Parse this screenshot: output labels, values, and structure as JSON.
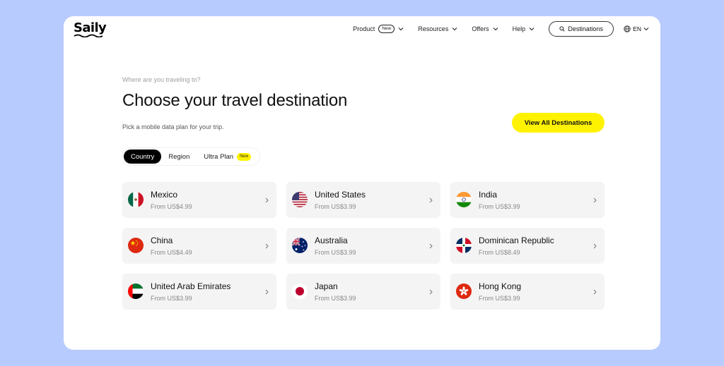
{
  "brand": {
    "name": "Saily"
  },
  "nav": {
    "items": [
      {
        "label": "Product",
        "badge": "New"
      },
      {
        "label": "Resources"
      },
      {
        "label": "Offers"
      },
      {
        "label": "Help"
      }
    ],
    "destinations_button": "Destinations",
    "language": "EN"
  },
  "hero": {
    "eyebrow": "Where are you traveling to?",
    "title": "Choose your travel destination",
    "subtitle": "Pick a mobile data plan for your trip.",
    "view_all_label": "View All Destinations"
  },
  "tabs": [
    {
      "label": "Country",
      "active": true
    },
    {
      "label": "Region",
      "active": false
    },
    {
      "label": "Ultra Plan",
      "badge": "New",
      "active": false
    }
  ],
  "countries": [
    {
      "name": "Mexico",
      "price": "From US$4.99",
      "flag": "mexico-flag-icon"
    },
    {
      "name": "United States",
      "price": "From US$3.99",
      "flag": "usa-flag-icon"
    },
    {
      "name": "India",
      "price": "From US$3.99",
      "flag": "india-flag-icon"
    },
    {
      "name": "China",
      "price": "From US$4.49",
      "flag": "china-flag-icon"
    },
    {
      "name": "Australia",
      "price": "From US$3.99",
      "flag": "australia-flag-icon"
    },
    {
      "name": "Dominican Republic",
      "price": "From US$8.49",
      "flag": "dominican-republic-flag-icon"
    },
    {
      "name": "United Arab Emirates",
      "price": "From US$3.99",
      "flag": "uae-flag-icon"
    },
    {
      "name": "Japan",
      "price": "From US$3.99",
      "flag": "japan-flag-icon"
    },
    {
      "name": "Hong Kong",
      "price": "From US$3.99",
      "flag": "hong-kong-flag-icon"
    }
  ],
  "colors": {
    "background": "#b8cbff",
    "accent_yellow": "#fff200",
    "card_bg": "#f4f4f4",
    "text_dark": "#111111",
    "text_muted": "#888888"
  }
}
